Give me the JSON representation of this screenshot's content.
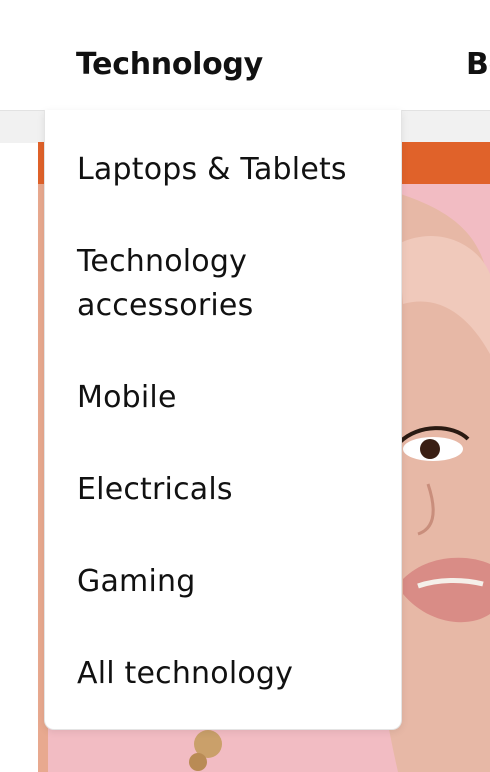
{
  "nav": {
    "items": [
      {
        "label": "Technology"
      },
      {
        "label": "Be"
      }
    ]
  },
  "dropdown": {
    "items": [
      {
        "label": "Laptops & Tablets"
      },
      {
        "label": "Technology accessories"
      },
      {
        "label": "Mobile"
      },
      {
        "label": "Electricals"
      },
      {
        "label": "Gaming"
      },
      {
        "label": "All technology"
      }
    ]
  },
  "colors": {
    "accent_orange": "#e0622a",
    "hero_pink": "#f2bcc3"
  }
}
